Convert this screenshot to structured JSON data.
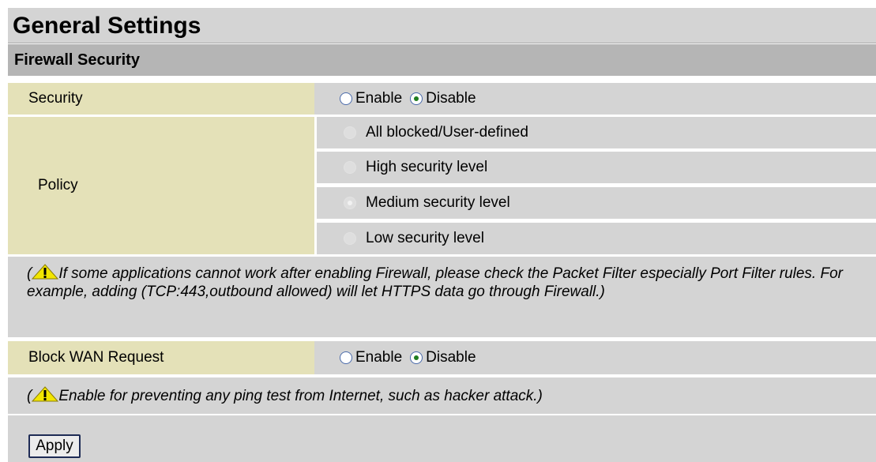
{
  "title": "General Settings",
  "section": "Firewall Security",
  "security": {
    "label": "Security",
    "options": [
      {
        "label": "Enable",
        "checked": false
      },
      {
        "label": "Disable",
        "checked": true
      }
    ]
  },
  "policy": {
    "label": "Policy",
    "options": [
      {
        "label": "All blocked/User-defined",
        "checked": false
      },
      {
        "label": "High security level",
        "checked": false
      },
      {
        "label": "Medium security level",
        "checked": true
      },
      {
        "label": "Low security level",
        "checked": false
      }
    ]
  },
  "firewall_note": {
    "open": "(",
    "text": "If some applications cannot work after enabling Firewall, please check the Packet Filter especially Port Filter rules. For example, adding (TCP:443,outbound allowed) will let HTTPS data go through Firewall.)"
  },
  "block_wan": {
    "label": "Block WAN Request",
    "options": [
      {
        "label": "Enable",
        "checked": false
      },
      {
        "label": "Disable",
        "checked": true
      }
    ]
  },
  "wan_note": {
    "open": "(",
    "text": "Enable for preventing any ping test from Internet, such as hacker attack.)"
  },
  "apply_label": "Apply",
  "icons": {
    "warning": "warning-icon",
    "radio": "radio-icon"
  },
  "colors": {
    "label_bg": "#e4e1b8",
    "value_bg": "#d4d4d4",
    "section_bg": "#b5b5b5",
    "warning": "#f2e600"
  }
}
